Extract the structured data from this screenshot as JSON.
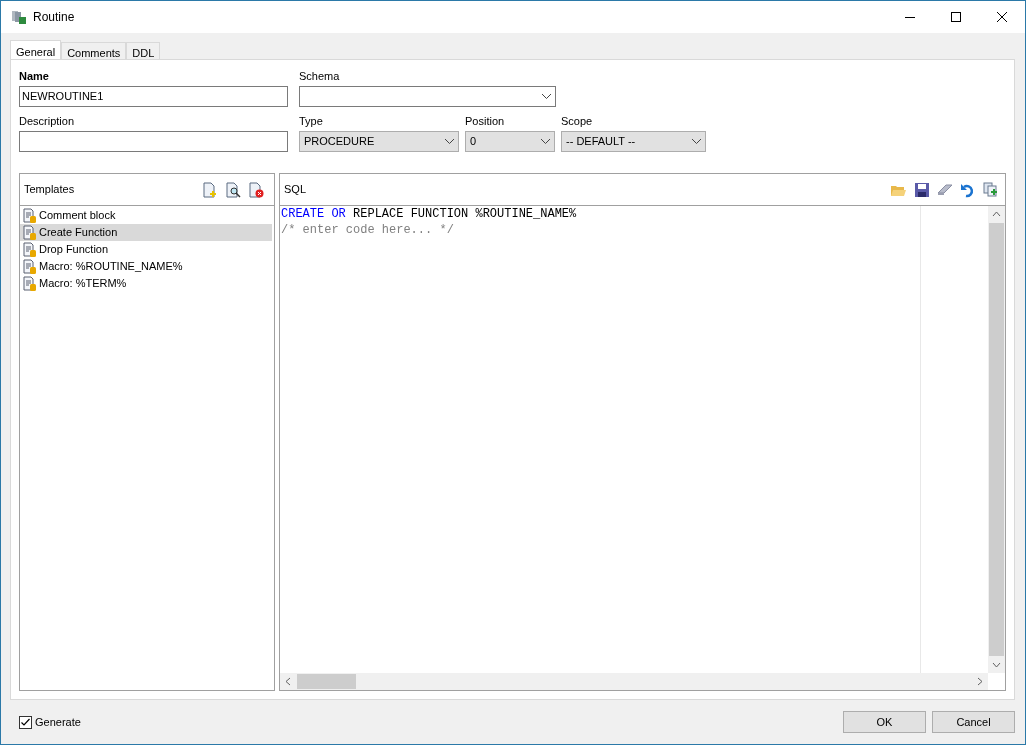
{
  "window": {
    "title": "Routine"
  },
  "tabs": [
    {
      "label": "General",
      "selected": true
    },
    {
      "label": "Comments",
      "selected": false
    },
    {
      "label": "DDL",
      "selected": false
    }
  ],
  "fields": {
    "name": {
      "label": "Name",
      "value": "NEWROUTINE1"
    },
    "schema": {
      "label": "Schema"
    },
    "description": {
      "label": "Description"
    },
    "type": {
      "label": "Type",
      "value": "PROCEDURE"
    },
    "position": {
      "label": "Position",
      "value": "0"
    },
    "scope": {
      "label": "Scope",
      "value": "-- DEFAULT --"
    }
  },
  "templates": {
    "title": "Templates",
    "items": [
      {
        "label": "Comment block",
        "selected": false
      },
      {
        "label": "Create Function",
        "selected": true
      },
      {
        "label": "Drop Function",
        "selected": false
      },
      {
        "label": "Macro: %ROUTINE_NAME%",
        "selected": false
      },
      {
        "label": "Macro: %TERM%",
        "selected": false
      }
    ]
  },
  "sql": {
    "title": "SQL",
    "lines": [
      [
        {
          "text": "CREATE",
          "kind": "keyword"
        },
        {
          "text": " OR",
          "kind": "keyword"
        },
        {
          "text": " REPLACE FUNCTION %ROUTINE_NAME%",
          "kind": "plain"
        }
      ],
      [
        {
          "text": "/* enter code here... */",
          "kind": "comment"
        }
      ]
    ]
  },
  "generate": {
    "label": "Generate",
    "checked": true
  },
  "buttons": [
    {
      "label": "OK"
    },
    {
      "label": "Cancel"
    }
  ]
}
